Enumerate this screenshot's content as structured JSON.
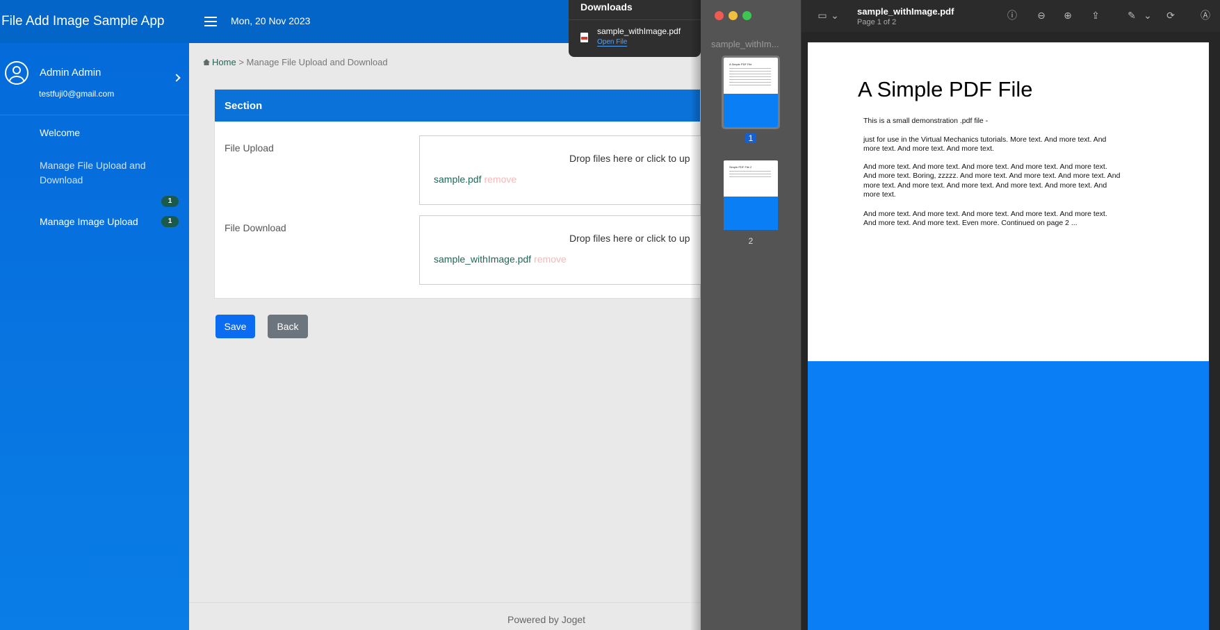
{
  "app": {
    "title": "File Add Image Sample App",
    "date": "Mon, 20 Nov 2023",
    "user_name": "Admin Admin",
    "user_email": "testfuji0@gmail.com"
  },
  "sidebar": {
    "items": [
      {
        "label": "Welcome"
      },
      {
        "label": "Manage File Upload and Download",
        "badge": "1"
      },
      {
        "label": "Manage Image Upload",
        "badge": "1"
      }
    ]
  },
  "breadcrumb": {
    "home": "Home",
    "separator": ">",
    "current": "Manage File Upload and Download"
  },
  "form": {
    "section_title": "Section",
    "fields": [
      {
        "label": "File Upload",
        "hint": "Drop files here or click to up",
        "file": "sample.pdf",
        "remove": "remove"
      },
      {
        "label": "File Download",
        "hint": "Drop files here or click to up",
        "file": "sample_withImage.pdf",
        "remove": "remove"
      }
    ],
    "save_label": "Save",
    "back_label": "Back"
  },
  "footer": {
    "text": "Powered by Joget"
  },
  "downloads": {
    "title": "Downloads",
    "file_name": "sample_withImage.pdf",
    "open_label": "Open File"
  },
  "preview": {
    "sidebar_title": "sample_withIm...",
    "doc_title": "sample_withImage.pdf",
    "page_info": "Page 1 of 2",
    "thumbnails": [
      {
        "number": "1",
        "title": "A Simple PDF File"
      },
      {
        "number": "2",
        "title": "Simple PDF File 2"
      }
    ],
    "page": {
      "title": "A Simple PDF File",
      "paragraphs": [
        "This is a small demonstration .pdf file -",
        "just for use in the Virtual Mechanics tutorials. More text. And more text. And more text. And more text. And more text.",
        "And more text. And more text. And more text. And more text. And more text. And more text. Boring, zzzzz. And more text. And more text. And more text. And more text. And more text. And more text. And more text. And more text. And more text.",
        "And more text. And more text. And more text. And more text. And more text. And more text. And more text. Even more. Continued on page 2 ..."
      ]
    }
  },
  "colors": {
    "sidebar": "#0469d9",
    "topbar": "#0465c9",
    "section_header": "#0a72d8",
    "save_button": "#0b6cf2",
    "back_button": "#6c757d",
    "pdf_blue": "#0a7ff5"
  }
}
